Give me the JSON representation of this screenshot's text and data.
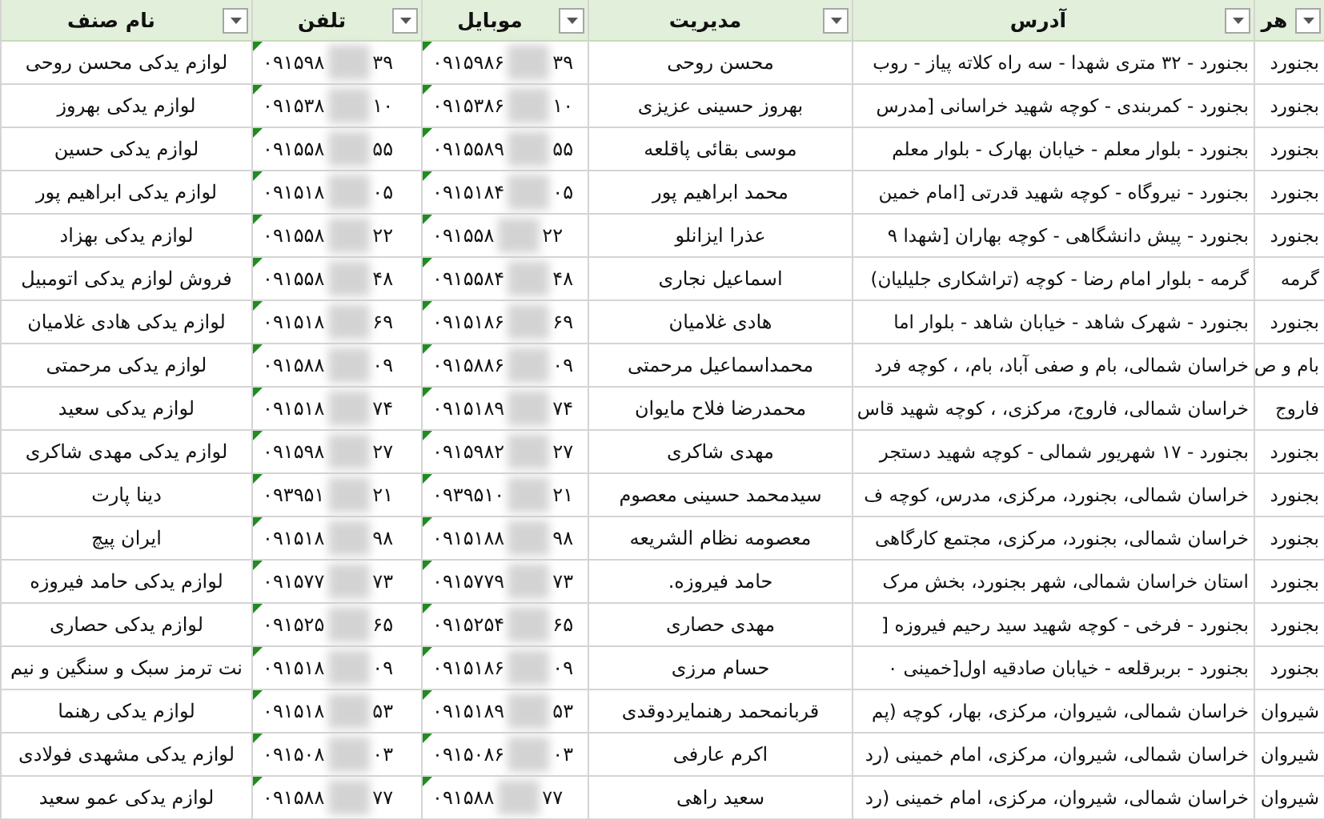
{
  "columns": [
    {
      "label": "هر"
    },
    {
      "label": "آدرس"
    },
    {
      "label": "مدیریت"
    },
    {
      "label": "موبایل"
    },
    {
      "label": "تلفن"
    },
    {
      "label": "نام صنف"
    }
  ],
  "rows": [
    {
      "city": "بجنورد",
      "address": "بجنورد - ۳۲ متری شهدا - سه راه کلاته پیاز - روب",
      "manager": "محسن روحی",
      "mobile": {
        "start": "۰۹۱۵۹۸۶",
        "end": "۳۹",
        "error_flag": true
      },
      "phone": {
        "start": "۰۹۱۵۹۸",
        "end": "۳۹",
        "error_flag": true
      },
      "name": "لوازم یدکی محسن روحی"
    },
    {
      "city": "بجنورد",
      "address": "بجنورد - کمربندی - کوچه شهید خراسانی [مدرس",
      "manager": "بهروز حسینی عزیزی",
      "mobile": {
        "start": "۰۹۱۵۳۸۶",
        "end": "۱۰",
        "error_flag": true
      },
      "phone": {
        "start": "۰۹۱۵۳۸",
        "end": "۱۰",
        "error_flag": true
      },
      "name": "لوازم یدکی بهروز"
    },
    {
      "city": "بجنورد",
      "address": "بجنورد - بلوار معلم - خیابان بهارک - بلوار معلم",
      "manager": "موسی بقائی پاقلعه",
      "mobile": {
        "start": "۰۹۱۵۵۸۹",
        "end": "۵۵",
        "error_flag": true
      },
      "phone": {
        "start": "۰۹۱۵۵۸",
        "end": "۵۵",
        "error_flag": true
      },
      "name": "لوازم یدکی حسین"
    },
    {
      "city": "بجنورد",
      "address": "بجنورد - نیروگاه - کوچه شهید قدرتی [امام خمین",
      "manager": "محمد ابراهیم پور",
      "mobile": {
        "start": "۰۹۱۵۱۸۴",
        "end": "۰۵",
        "error_flag": true
      },
      "phone": {
        "start": "۰۹۱۵۱۸",
        "end": "۰۵",
        "error_flag": true
      },
      "name": "لوازم یدکی ابراهیم پور"
    },
    {
      "city": "بجنورد",
      "address": "بجنورد - پیش دانشگاهی - کوچه بهاران [شهدا ۹",
      "manager": "عذرا ایزانلو",
      "mobile": {
        "start": "۰۹۱۵۵۸",
        "end": "۲۲",
        "error_flag": true
      },
      "phone": {
        "start": "۰۹۱۵۵۸",
        "end": "۲۲",
        "error_flag": true
      },
      "name": "لوازم یدکی بهزاد"
    },
    {
      "city": "گرمه",
      "address": "گرمه - بلوار امام رضا - کوچه (تراشکاری جلیلیان)",
      "manager": "اسماعیل نجاری",
      "mobile": {
        "start": "۰۹۱۵۵۸۴",
        "end": "۴۸",
        "error_flag": true
      },
      "phone": {
        "start": "۰۹۱۵۵۸",
        "end": "۴۸",
        "error_flag": true
      },
      "name": "فروش لوازم یدکی اتومبیل"
    },
    {
      "city": "بجنورد",
      "address": "بجنورد - شهرک شاهد - خیابان شاهد - بلوار اما",
      "manager": "هادی غلامیان",
      "mobile": {
        "start": "۰۹۱۵۱۸۶",
        "end": "۶۹",
        "error_flag": true
      },
      "phone": {
        "start": "۰۹۱۵۱۸",
        "end": "۶۹",
        "error_flag": true
      },
      "name": "لوازم یدکی هادی غلامیان"
    },
    {
      "city": "بام و ص",
      "address": "خراسان شمالی، بام و صفی آباد، بام، ، کوچه فرد",
      "manager": "محمداسماعیل مرحمتی",
      "mobile": {
        "start": "۰۹۱۵۸۸۶",
        "end": "۰۹",
        "error_flag": true
      },
      "phone": {
        "start": "۰۹۱۵۸۸",
        "end": "۰۹",
        "error_flag": true
      },
      "name": "لوازم یدکی مرحمتی"
    },
    {
      "city": "فاروج",
      "address": "خراسان شمالی، فاروج، مرکزی، ، کوچه شهید قاس",
      "manager": "محمدرضا فلاح مایوان",
      "mobile": {
        "start": "۰۹۱۵۱۸۹",
        "end": "۷۴",
        "error_flag": true
      },
      "phone": {
        "start": "۰۹۱۵۱۸",
        "end": "۷۴",
        "error_flag": true
      },
      "name": "لوازم یدکی سعید"
    },
    {
      "city": "بجنورد",
      "address": "بجنورد - ۱۷ شهریور شمالی - کوچه شهید دستجر",
      "manager": "مهدی شاکری",
      "mobile": {
        "start": "۰۹۱۵۹۸۲",
        "end": "۲۷",
        "error_flag": true
      },
      "phone": {
        "start": "۰۹۱۵۹۸",
        "end": "۲۷",
        "error_flag": true
      },
      "name": "لوازم یدکی مهدی شاکری"
    },
    {
      "city": "بجنورد",
      "address": "خراسان شمالی، بجنورد، مرکزی، مدرس، کوچه ف",
      "manager": "سیدمحمد حسینی معصوم",
      "mobile": {
        "start": "۰۹۳۹۵۱۰",
        "end": "۲۱",
        "error_flag": true
      },
      "phone": {
        "start": "۰۹۳۹۵۱",
        "end": "۲۱",
        "error_flag": true
      },
      "name": "دینا پارت"
    },
    {
      "city": "بجنورد",
      "address": "خراسان شمالی، بجنورد، مرکزی، مجتمع کارگاهی",
      "manager": "معصومه نظام الشریعه",
      "mobile": {
        "start": "۰۹۱۵۱۸۸",
        "end": "۹۸",
        "error_flag": true
      },
      "phone": {
        "start": "۰۹۱۵۱۸",
        "end": "۹۸",
        "error_flag": true
      },
      "name": "ایران پیچ"
    },
    {
      "city": "بجنورد",
      "address": "استان خراسان شمالی،  شهر بجنورد،  بخش مرک",
      "manager": "حامد فیروزه.",
      "mobile": {
        "start": "۰۹۱۵۷۷۹",
        "end": "۷۳",
        "error_flag": true
      },
      "phone": {
        "start": "۰۹۱۵۷۷",
        "end": "۷۳",
        "error_flag": true
      },
      "name": "لوازم یدکی حامد فیروزه"
    },
    {
      "city": "بجنورد",
      "address": "بجنورد - فرخی - کوچه شهید سید رحیم فیروزه [",
      "manager": "مهدی حصاری",
      "mobile": {
        "start": "۰۹۱۵۲۵۴",
        "end": "۶۵",
        "error_flag": true
      },
      "phone": {
        "start": "۰۹۱۵۲۵",
        "end": "۶۵",
        "error_flag": true
      },
      "name": "لوازم یدکی حصاری"
    },
    {
      "city": "بجنورد",
      "address": "بجنورد - بربرقلعه - خیابان صادقیه اول[خمینی ۰",
      "manager": "حسام مرزی",
      "mobile": {
        "start": "۰۹۱۵۱۸۶",
        "end": "۰۹",
        "error_flag": true
      },
      "phone": {
        "start": "۰۹۱۵۱۸",
        "end": "۰۹",
        "error_flag": true
      },
      "name": "نت ترمز سبک و سنگین و نیم"
    },
    {
      "city": "شیروان",
      "address": "خراسان شمالی، شیروان، مرکزی، بهار، کوچه (پم",
      "manager": "قربانمحمد رهنمایردوقدی",
      "mobile": {
        "start": "۰۹۱۵۱۸۹",
        "end": "۵۳",
        "error_flag": true
      },
      "phone": {
        "start": "۰۹۱۵۱۸",
        "end": "۵۳",
        "error_flag": true
      },
      "name": "لوازم یدکی رهنما"
    },
    {
      "city": "شیروان",
      "address": "خراسان شمالی، شیروان، مرکزی، امام خمینی (رد",
      "manager": "اکرم عارفی",
      "mobile": {
        "start": "۰۹۱۵۰۸۶",
        "end": "۰۳",
        "error_flag": true
      },
      "phone": {
        "start": "۰۹۱۵۰۸",
        "end": "۰۳",
        "error_flag": true
      },
      "name": "لوازم یدکی مشهدی فولادی"
    },
    {
      "city": "شیروان",
      "address": "خراسان شمالی، شیروان، مرکزی، امام خمینی (رد",
      "manager": "سعید راهی",
      "mobile": {
        "start": "۰۹۱۵۸۸",
        "end": "۷۷",
        "error_flag": true
      },
      "phone": {
        "start": "۰۹۱۵۸۸",
        "end": "۷۷",
        "error_flag": true
      },
      "name": "لوازم یدکی عمو سعید"
    }
  ]
}
